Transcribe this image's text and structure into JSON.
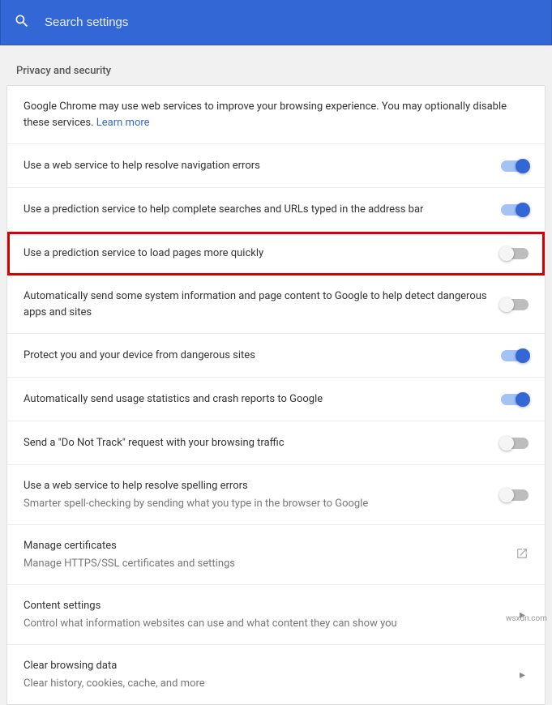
{
  "search": {
    "placeholder": "Search settings"
  },
  "section": {
    "title": "Privacy and security"
  },
  "intro": {
    "text": "Google Chrome may use web services to improve your browsing experience. You may optionally disable these services. ",
    "link": "Learn more"
  },
  "items": [
    {
      "title": "Use a web service to help resolve navigation errors",
      "toggle": "on"
    },
    {
      "title": "Use a prediction service to help complete searches and URLs typed in the address bar",
      "toggle": "on"
    },
    {
      "title": "Use a prediction service to load pages more quickly",
      "toggle": "off",
      "highlight": true
    },
    {
      "title": "Automatically send some system information and page content to Google to help detect dangerous apps and sites",
      "toggle": "off"
    },
    {
      "title": "Protect you and your device from dangerous sites",
      "toggle": "on"
    },
    {
      "title": "Automatically send usage statistics and crash reports to Google",
      "toggle": "on"
    },
    {
      "title": "Send a \"Do Not Track\" request with your browsing traffic",
      "toggle": "off"
    },
    {
      "title": "Use a web service to help resolve spelling errors",
      "sub": "Smarter spell-checking by sending what you type in the browser to Google",
      "toggle": "off"
    },
    {
      "title": "Manage certificates",
      "sub": "Manage HTTPS/SSL certificates and settings",
      "action": "external"
    },
    {
      "title": "Content settings",
      "sub": "Control what information websites can use and what content they can show you",
      "action": "chevron"
    },
    {
      "title": "Clear browsing data",
      "sub": "Clear history, cookies, cache, and more",
      "action": "chevron"
    }
  ],
  "watermark": "wsxdn.com"
}
